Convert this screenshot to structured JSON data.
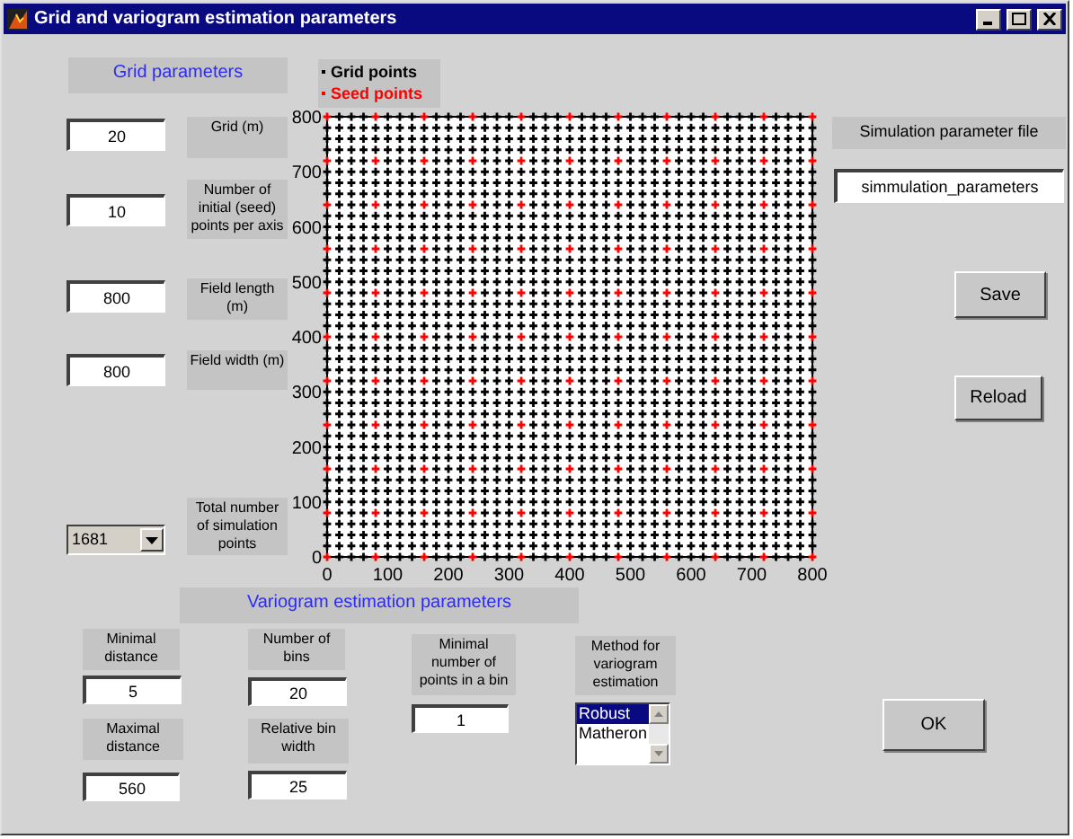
{
  "window": {
    "title": "Grid and variogram estimation parameters"
  },
  "grid_parameters": {
    "heading": "Grid parameters",
    "fields": [
      {
        "label": "Grid (m)",
        "value": "20"
      },
      {
        "label": "Number of initial (seed) points per axis",
        "value": "10"
      },
      {
        "label": "Field length (m)",
        "value": "800"
      },
      {
        "label": "Field width (m)",
        "value": "800"
      }
    ],
    "total": {
      "label": "Total number of simulation points",
      "value": "1681"
    }
  },
  "plot": {
    "x_axis_labels": [
      "0",
      "100",
      "200",
      "300",
      "400",
      "500",
      "600",
      "700",
      "800"
    ],
    "y_axis_labels": [
      "800",
      "700",
      "600",
      "500",
      "400",
      "300",
      "200",
      "100",
      "0"
    ],
    "legend": [
      {
        "label": "Grid points",
        "color": "#000000"
      },
      {
        "label": "Seed points",
        "color": "#ff0000"
      }
    ]
  },
  "simulation_file": {
    "label": "Simulation parameter file",
    "value": "simmulation_parameters"
  },
  "file_buttons": [
    "Save",
    "Reload"
  ],
  "variogram": {
    "heading": "Variogram estimation parameters",
    "min_distance": {
      "label": "Minimal distance",
      "value": "5"
    },
    "max_distance": {
      "label": "Maximal distance",
      "value": "560"
    },
    "bins": {
      "label": "Number of bins",
      "value": "20"
    },
    "bin_width": {
      "label": "Relative bin width",
      "value": "25"
    },
    "min_points": {
      "label": "Minimal number of points in a bin",
      "value": "1"
    },
    "method": {
      "label": "Method for variogram estimation",
      "options": [
        {
          "label": "Robust",
          "selected": true
        },
        {
          "label": "Matheron",
          "selected": false
        }
      ]
    }
  },
  "ok_button": "OK"
}
